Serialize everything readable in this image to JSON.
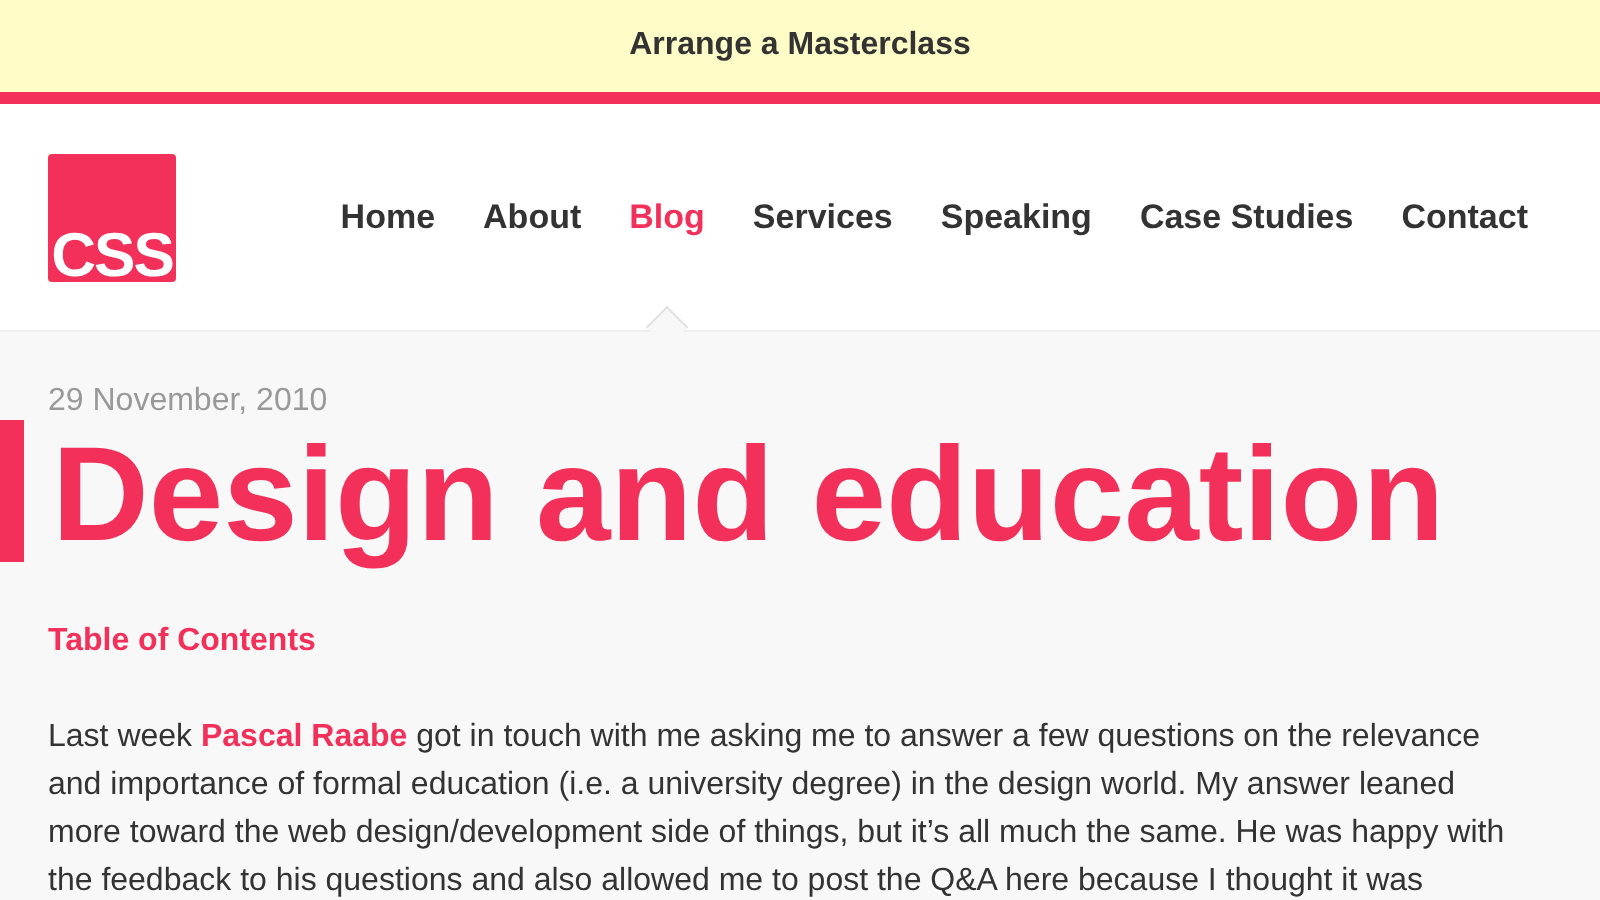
{
  "banner": {
    "text": "Arrange a Masterclass"
  },
  "logo": {
    "text": "CSS"
  },
  "nav": [
    {
      "label": "Home",
      "selected": false
    },
    {
      "label": "About",
      "selected": false
    },
    {
      "label": "Blog",
      "selected": true
    },
    {
      "label": "Services",
      "selected": false
    },
    {
      "label": "Speaking",
      "selected": false
    },
    {
      "label": "Case Studies",
      "selected": false
    },
    {
      "label": "Contact",
      "selected": false
    }
  ],
  "post": {
    "date": "29 November, 2010",
    "title": "Design and education",
    "toc": "Table of Contents",
    "intro": {
      "before": "Last week ",
      "link": "Pascal Raabe",
      "after": " got in touch with me asking me to answer a few questions on the relevance and importance of formal education (i.e. a university degree) in the design world. My answer leaned more toward the web design/development side of things, but it’s all much the same. He was happy with the feedback to his questions and also allowed me to post the Q&A here because I thought it was"
    }
  }
}
